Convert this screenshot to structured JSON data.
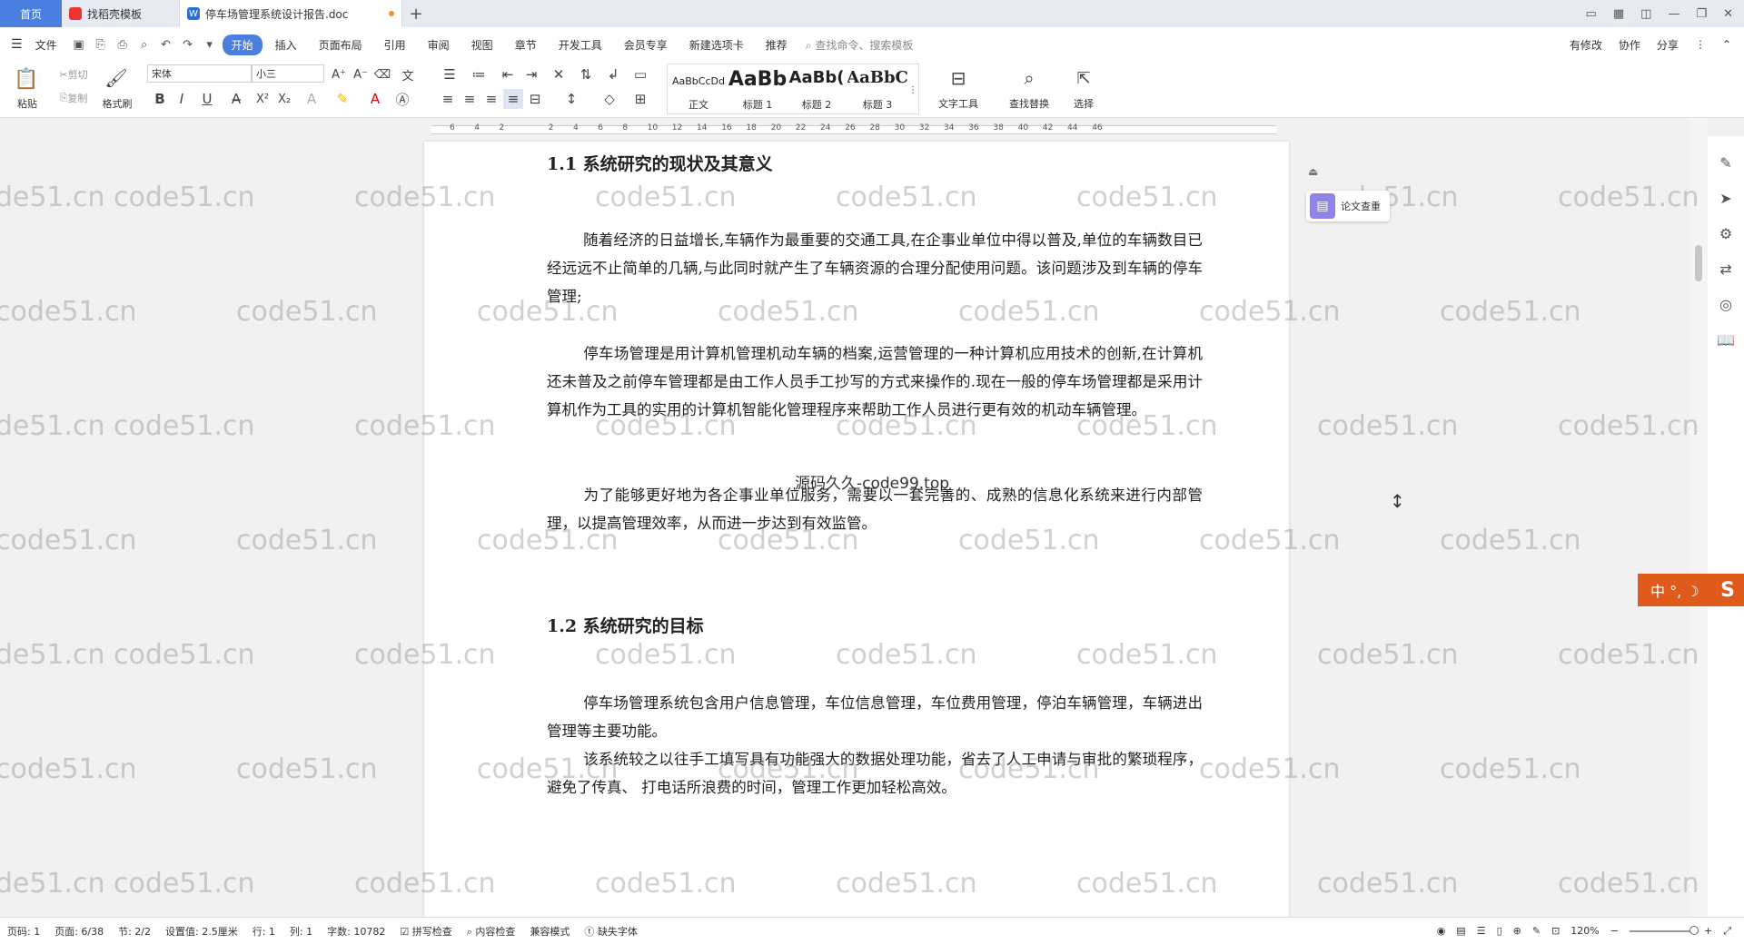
{
  "tabs": {
    "home": "首页",
    "template": "找稻壳模板",
    "document": "停车场管理系统设计报告.doc",
    "add": "+"
  },
  "menu": {
    "file": "文件",
    "items": [
      "开始",
      "插入",
      "页面布局",
      "引用",
      "审阅",
      "视图",
      "章节",
      "开发工具",
      "会员专享",
      "新建选项卡",
      "推荐"
    ],
    "search_placeholder": "查找命令、搜索模板",
    "right": [
      "有修改",
      "协作",
      "分享"
    ]
  },
  "ribbon": {
    "paste": "粘贴",
    "cut": "剪切",
    "copy": "复制",
    "format_painter": "格式刷",
    "font_name": "宋体",
    "font_size": "小三",
    "styles": [
      {
        "sample": "AaBbCcDd",
        "label": "正文"
      },
      {
        "sample": "AaBb",
        "label": "标题 1"
      },
      {
        "sample": "AaBb(",
        "label": "标题 2"
      },
      {
        "sample": "AaBbC",
        "label": "标题 3"
      }
    ],
    "text_tools": "文字工具",
    "find_replace": "查找替换",
    "select": "选择"
  },
  "ruler": {
    "ticks": [
      "6",
      "4",
      "2",
      "",
      "2",
      "4",
      "6",
      "8",
      "10",
      "12",
      "14",
      "16",
      "18",
      "20",
      "22",
      "24",
      "26",
      "28",
      "30",
      "32",
      "34",
      "36",
      "38",
      "40",
      "42",
      "44",
      "46"
    ]
  },
  "document": {
    "h1": "1.1  系统研究的现状及其意义",
    "p1": "随着经济的日益增长,车辆作为最重要的交通工具,在企事业单位中得以普及,单位的车辆数目已经远远不止简单的几辆,与此同时就产生了车辆资源的合理分配使用问题。该问题涉及到车辆的停车管理;",
    "p2": "停车场管理是用计算机管理机动车辆的档案,运营管理的一种计算机应用技术的创新,在计算机还未普及之前停车管理都是由工作人员手工抄写的方式来操作的.现在一般的停车场管理都是采用计算机作为工具的实用的计算机智能化管理程序来帮助工作人员进行更有效的机动车辆管理。",
    "p3": "为了能够更好地为各企事业单位服务，需要以一套完善的、成熟的信息化系统来进行内部管理，以提高管理效率，从而进一步达到有效监管。",
    "h2": "1.2  系统研究的目标",
    "p4": "停车场管理系统包含用户信息管理，车位信息管理，车位费用管理，停泊车辆管理，车辆进出管理等主要功能。",
    "p5": "该系统较之以往手工填写具有功能强大的数据处理功能，省去了人工申请与审批的繁琐程序，避免了传真、 打电话所浪费的时间，管理工作更加轻松高效。",
    "center_mark": "源码久久-code99.top",
    "watermark": "code51.cn"
  },
  "side_panel": {
    "label": "论文查重"
  },
  "ime": {
    "label": "中 °, ☽"
  },
  "status": {
    "page_no": "页码: 1",
    "page": "页面: 6/38",
    "section": "节: 2/2",
    "setting": "设置值: 2.5厘米",
    "row": "行: 1",
    "col": "列: 1",
    "words": "字数: 10782",
    "spell": "拼写检查",
    "content_check": "内容检查",
    "compat": "兼容模式",
    "missing_font": "缺失字体",
    "zoom": "120%"
  }
}
